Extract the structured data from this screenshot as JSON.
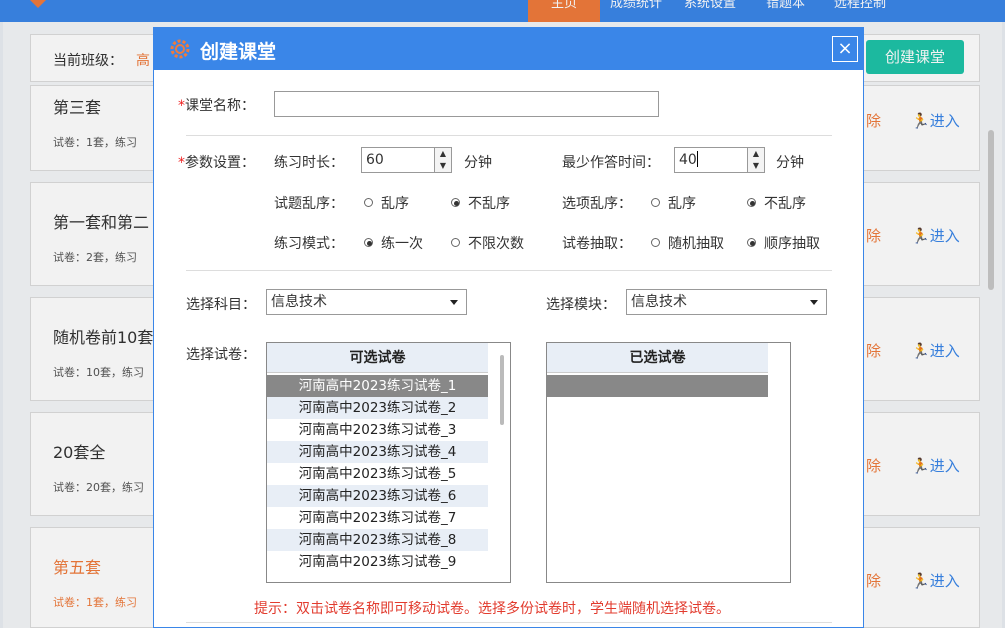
{
  "topnav": {
    "items": [
      {
        "label": "主页",
        "active": true
      },
      {
        "label": "成绩统计"
      },
      {
        "label": "系统设置"
      },
      {
        "label": "错题本"
      },
      {
        "label": "远程控制"
      }
    ]
  },
  "class_bar": {
    "label": "当前班级：",
    "value": "高"
  },
  "create_button": "创建课堂",
  "cards": [
    {
      "title": "第三套",
      "meta": "试卷：1套，练习",
      "delete": "除",
      "enter": "进入"
    },
    {
      "title": "第一套和第二",
      "meta": "试卷：2套，练习",
      "delete": "除",
      "enter": "进入"
    },
    {
      "title": "随机卷前10套",
      "meta": "试卷：10套，练习",
      "delete": "除",
      "enter": "进入"
    },
    {
      "title": "20套全",
      "meta": "试卷：20套，练习",
      "delete": "除",
      "enter": "进入"
    },
    {
      "title": "第五套",
      "meta": "试卷：1套，练习",
      "delete": "除",
      "enter": "进入"
    }
  ],
  "modal": {
    "title": "创建课堂",
    "close": "×",
    "name_label": "课堂名称：",
    "name_value": "",
    "params_label": "参数设置：",
    "duration_label": "练习时长：",
    "duration_value": "60",
    "duration_unit": "分钟",
    "min_time_label": "最少作答时间：",
    "min_time_value": "40",
    "min_time_unit": "分钟",
    "shuffle_q_label": "试题乱序：",
    "shuffle_q_options": [
      "乱序",
      "不乱序"
    ],
    "shuffle_o_label": "选项乱序：",
    "shuffle_o_options": [
      "乱序",
      "不乱序"
    ],
    "mode_label": "练习模式：",
    "mode_options": [
      "练一次",
      "不限次数"
    ],
    "draw_label": "试卷抽取：",
    "draw_options": [
      "随机抽取",
      "顺序抽取"
    ],
    "subject_label": "选择科目：",
    "subject_value": "信息技术",
    "module_label": "选择模块：",
    "module_value": "信息技术",
    "paper_label": "选择试卷：",
    "available_header": "可选试卷",
    "selected_header": "已选试卷",
    "available_papers": [
      "河南高中2023练习试卷_1",
      "河南高中2023练习试卷_2",
      "河南高中2023练习试卷_3",
      "河南高中2023练习试卷_4",
      "河南高中2023练习试卷_5",
      "河南高中2023练习试卷_6",
      "河南高中2023练习试卷_7",
      "河南高中2023练习试卷_8",
      "河南高中2023练习试卷_9"
    ],
    "hint": "提示：双击试卷名称即可移动试卷。选择多份试卷时，学生端随机选择试卷。"
  },
  "colors": {
    "primary": "#3a86e8",
    "accent": "#f07b3b",
    "create": "#1ec3a8",
    "hint": "#e23b2e"
  }
}
